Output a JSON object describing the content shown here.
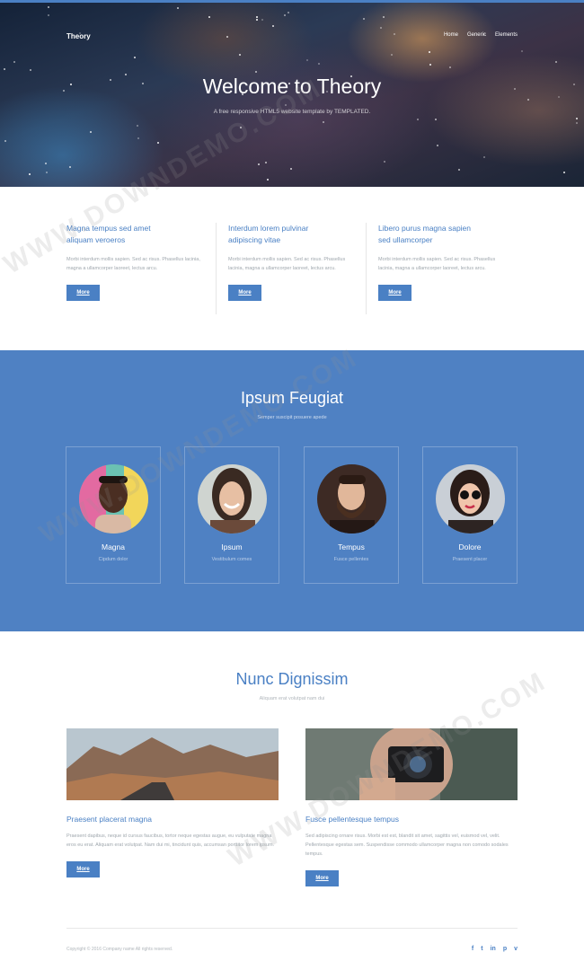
{
  "header": {
    "logo": "Theory",
    "nav": [
      "Home",
      "Generic",
      "Elements"
    ],
    "title": "Welcome to Theory",
    "subtitle": "A free responsive HTML5 website template by TEMPLATED."
  },
  "features": [
    {
      "title": "Magna tempus sed amet aliquam veroeros",
      "text": "Morbi interdum mollis sapien. Sed ac risus. Phasellus lacinia, magna a ullamcorper laoreet, lectus arcu.",
      "button": "More"
    },
    {
      "title": "Interdum lorem pulvinar adipiscing vitae",
      "text": "Morbi interdum mollis sapien. Sed ac risus. Phasellus lacinia, magna a ullamcorper laoreet, lectus arcu.",
      "button": "More"
    },
    {
      "title": "Libero purus magna sapien sed ullamcorper",
      "text": "Morbi interdum mollis sapien. Sed ac risus. Phasellus lacinia, magna a ullamcorper laoreet, lectus arcu.",
      "button": "More"
    }
  ],
  "team": {
    "title": "Ipsum Feugiat",
    "subtitle": "Semper suscipit posuere apede",
    "members": [
      {
        "name": "Magna",
        "role": "Cipdum dolor"
      },
      {
        "name": "Ipsum",
        "role": "Vestibulum comes"
      },
      {
        "name": "Tempus",
        "role": "Fusce pellentes"
      },
      {
        "name": "Dolore",
        "role": "Praesent placer"
      }
    ]
  },
  "articles": {
    "title": "Nunc Dignissim",
    "subtitle": "Aliquam erat volutpat nam dui",
    "items": [
      {
        "title": "Praesent placerat magna",
        "text": "Praesent dapibus, neque id cursus faucibus, tortor neque egestas augue, eu vulputate magna eros eu erat. Aliquam erat volutpat. Nam dui mi, tincidunt quis, accumsan porttitor lorem ipsum.",
        "button": "More"
      },
      {
        "title": "Fusce pellentesque tempus",
        "text": "Sed adipiscing ornare risus. Morbi est est, blandit sit amet, sagittis vel, euismod vel, velit. Pellentesque egestas sem. Suspendisse commodo ullamcorper magna non comodo sodales tempus.",
        "button": "More"
      }
    ]
  },
  "footer": {
    "copyright": "Copyright © 2016 Company name All rights reserved.",
    "social": [
      "f",
      "t",
      "in",
      "p",
      "v"
    ],
    "social_names": [
      "facebook-icon",
      "twitter-icon",
      "linkedin-icon",
      "pinterest-icon",
      "vimeo-icon"
    ]
  },
  "watermark": "WWW.DOWNDEMO.COM",
  "colors": {
    "accent": "#4a80c4",
    "team_bg": "#4f81c3"
  }
}
